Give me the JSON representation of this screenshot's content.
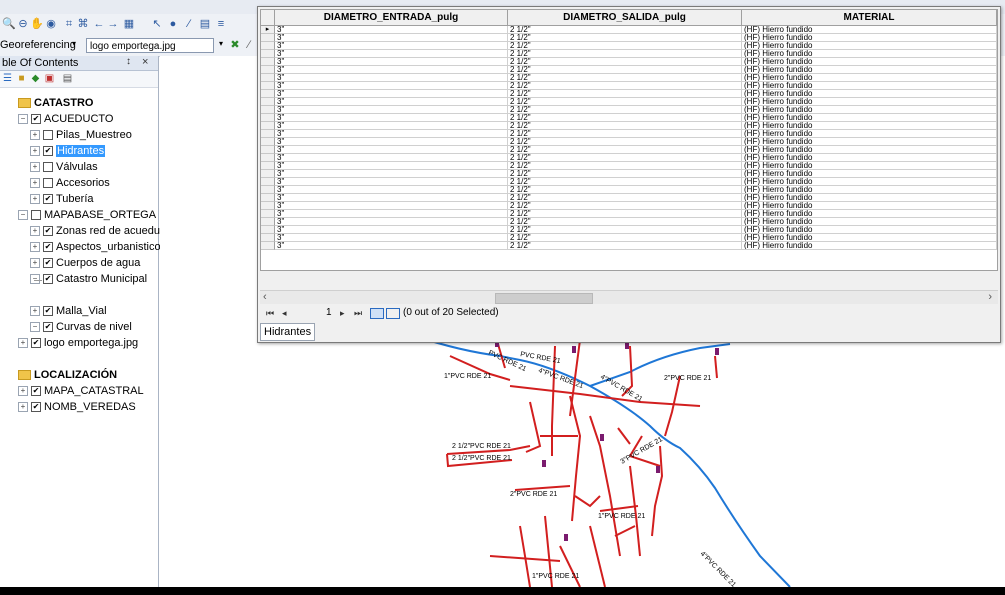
{
  "toolbar": {
    "georeferencing_label": "Georeferencing",
    "layer_select_value": "logo emportega.jpg"
  },
  "toc": {
    "title": "ble Of Contents",
    "pin": "↕",
    "close": "×",
    "items": [
      {
        "label": "CATASTRO",
        "kind": "group",
        "expand": "",
        "checked": ""
      },
      {
        "label": "ACUEDUCTO",
        "kind": "layer",
        "expand": "−",
        "checked": "✔"
      },
      {
        "label": "Pilas_Muestreo",
        "kind": "layer",
        "expand": "+",
        "checked": ""
      },
      {
        "label": "Hidrantes",
        "kind": "layer",
        "expand": "+",
        "checked": "✔",
        "selected": true
      },
      {
        "label": "Válvulas",
        "kind": "layer",
        "expand": "+",
        "checked": ""
      },
      {
        "label": "Accesorios",
        "kind": "layer",
        "expand": "+",
        "checked": ""
      },
      {
        "label": "Tubería",
        "kind": "layer",
        "expand": "+",
        "checked": "✔"
      },
      {
        "label": "MAPABASE_ORTEGA",
        "kind": "layer",
        "expand": "−",
        "checked": ""
      },
      {
        "label": "Zonas red de acueduc",
        "kind": "layer",
        "expand": "+",
        "checked": "✔"
      },
      {
        "label": "Aspectos_urbanisticos",
        "kind": "layer",
        "expand": "+",
        "checked": "✔"
      },
      {
        "label": "Cuerpos de agua",
        "kind": "layer",
        "expand": "+",
        "checked": "✔"
      },
      {
        "label": "Catastro Municipal",
        "kind": "layer",
        "expand": "−",
        "checked": "✔"
      },
      {
        "label": "Malla_Vial",
        "kind": "layer",
        "expand": "+",
        "checked": "✔"
      },
      {
        "label": "Curvas de nivel",
        "kind": "layer",
        "expand": "−",
        "checked": "✔"
      },
      {
        "label": "logo emportega.jpg",
        "kind": "layer",
        "expand": "+",
        "checked": "✔"
      },
      {
        "label": "LOCALIZACIÓN",
        "kind": "group",
        "expand": "",
        "checked": ""
      },
      {
        "label": "MAPA_CATASTRAL",
        "kind": "layer",
        "expand": "+",
        "checked": "✔"
      },
      {
        "label": "NOMB_VEREDAS",
        "kind": "layer",
        "expand": "+",
        "checked": "✔"
      }
    ]
  },
  "table": {
    "columns": [
      "DIAMETRO_ENTRADA_pulg",
      "DIAMETRO_SALIDA_pulg",
      "MATERIAL"
    ],
    "rows": [
      [
        "3\"",
        "2 1/2\"",
        "(HF) Hierro fundido"
      ],
      [
        "3\"",
        "2 1/2\"",
        "(HF) Hierro fundido"
      ],
      [
        "3\"",
        "2 1/2\"",
        "(HF) Hierro fundido"
      ],
      [
        "3\"",
        "2 1/2\"",
        "(HF) Hierro fundido"
      ],
      [
        "3\"",
        "2 1/2\"",
        "(HF) Hierro fundido"
      ],
      [
        "3\"",
        "2 1/2\"",
        "(HF) Hierro fundido"
      ],
      [
        "3\"",
        "2 1/2\"",
        "(HF) Hierro fundido"
      ],
      [
        "3\"",
        "2 1/2\"",
        "(HF) Hierro fundido"
      ],
      [
        "3\"",
        "2 1/2\"",
        "(HF) Hierro fundido"
      ],
      [
        "3\"",
        "2 1/2\"",
        "(HF) Hierro fundido"
      ],
      [
        "3\"",
        "2 1/2\"",
        "(HF) Hierro fundido"
      ],
      [
        "3\"",
        "2 1/2\"",
        "(HF) Hierro fundido"
      ],
      [
        "3\"",
        "2 1/2\"",
        "(HF) Hierro fundido"
      ],
      [
        "3\"",
        "2 1/2\"",
        "(HF) Hierro fundido"
      ],
      [
        "3\"",
        "2 1/2\"",
        "(HF) Hierro fundido"
      ],
      [
        "3\"",
        "2 1/2\"",
        "(HF) Hierro fundido"
      ],
      [
        "3\"",
        "2 1/2\"",
        "(HF) Hierro fundido"
      ],
      [
        "3\"",
        "2 1/2\"",
        "(HF) Hierro fundido"
      ],
      [
        "3\"",
        "2 1/2\"",
        "(HF) Hierro fundido"
      ],
      [
        "3\"",
        "2 1/2\"",
        "(HF) Hierro fundido"
      ],
      [
        "3\"",
        "2 1/2\"",
        "(HF) Hierro fundido"
      ],
      [
        "3\"",
        "2 1/2\"",
        "(HF) Hierro fundido"
      ],
      [
        "3\"",
        "2 1/2\"",
        "(HF) Hierro fundido"
      ],
      [
        "3\"",
        "2 1/2\"",
        "(HF) Hierro fundido"
      ],
      [
        "3\"",
        "2 1/2\"",
        "(HF) Hierro fundido"
      ],
      [
        "3\"",
        "2 1/2\"",
        "(HF) Hierro fundido"
      ],
      [
        "3\"",
        "2 1/2\"",
        "(HF) Hierro fundido"
      ],
      [
        "3\"",
        "2 1/2\"",
        "(HF) Hierro fundido"
      ]
    ],
    "nav_current": "1",
    "selection_status": "(0 out of 20 Selected)",
    "tab_label": "Hidrantes"
  },
  "map": {
    "pipe_labels": [
      "1\"PVC RDE 21",
      "PVC RDE 21",
      "4\"PVC RDE 21",
      "2\"PVC RDE 21",
      "2 1/2\"PVC RDE 21",
      "2 1/2\"PVC RDE 21",
      "2\"PVC RDE 21",
      "1\"PVC RDE 21",
      "3\"PVC RDE 21",
      "4\"PVC RDE 21",
      "1\"PVC RDE 21",
      "PVC RDE 21",
      "4\"PVC RDE 21"
    ],
    "colors": {
      "pipe": "#d21f1f",
      "river": "#1f77d6",
      "valve": "#7a1b6e"
    }
  }
}
